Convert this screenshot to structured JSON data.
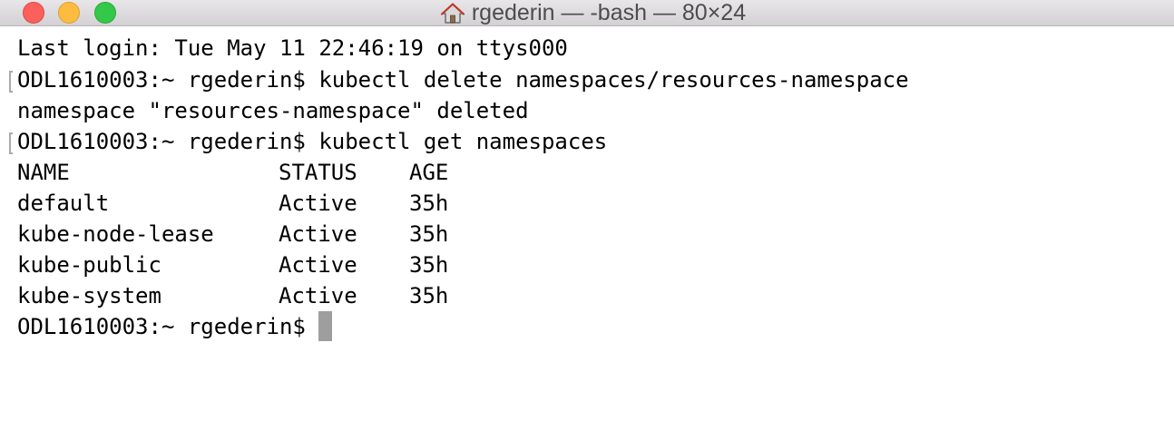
{
  "window": {
    "title": "rgederin — -bash — 80×24",
    "title_icon": "home-icon",
    "controls": {
      "close": "close-button",
      "minimize": "minimize-button",
      "zoom": "zoom-button"
    },
    "colors": {
      "close": "#fc605c",
      "minimize": "#fdbc40",
      "zoom": "#34c84a",
      "cursor": "#9e9e9e"
    }
  },
  "terminal": {
    "lines": [
      "Last login: Tue May 11 22:46:19 on ttys000",
      "ODL1610003:~ rgederin$ kubectl delete namespaces/resources-namespace",
      "namespace \"resources-namespace\" deleted",
      "ODL1610003:~ rgederin$ kubectl get namespaces"
    ],
    "table": {
      "headers": [
        "NAME",
        "STATUS",
        "AGE"
      ],
      "rows": [
        [
          "default",
          "Active",
          "35h"
        ],
        [
          "kube-node-lease",
          "Active",
          "35h"
        ],
        [
          "kube-public",
          "Active",
          "35h"
        ],
        [
          "kube-system",
          "Active",
          "35h"
        ]
      ]
    },
    "prompt": "ODL1610003:~ rgederin$ "
  }
}
